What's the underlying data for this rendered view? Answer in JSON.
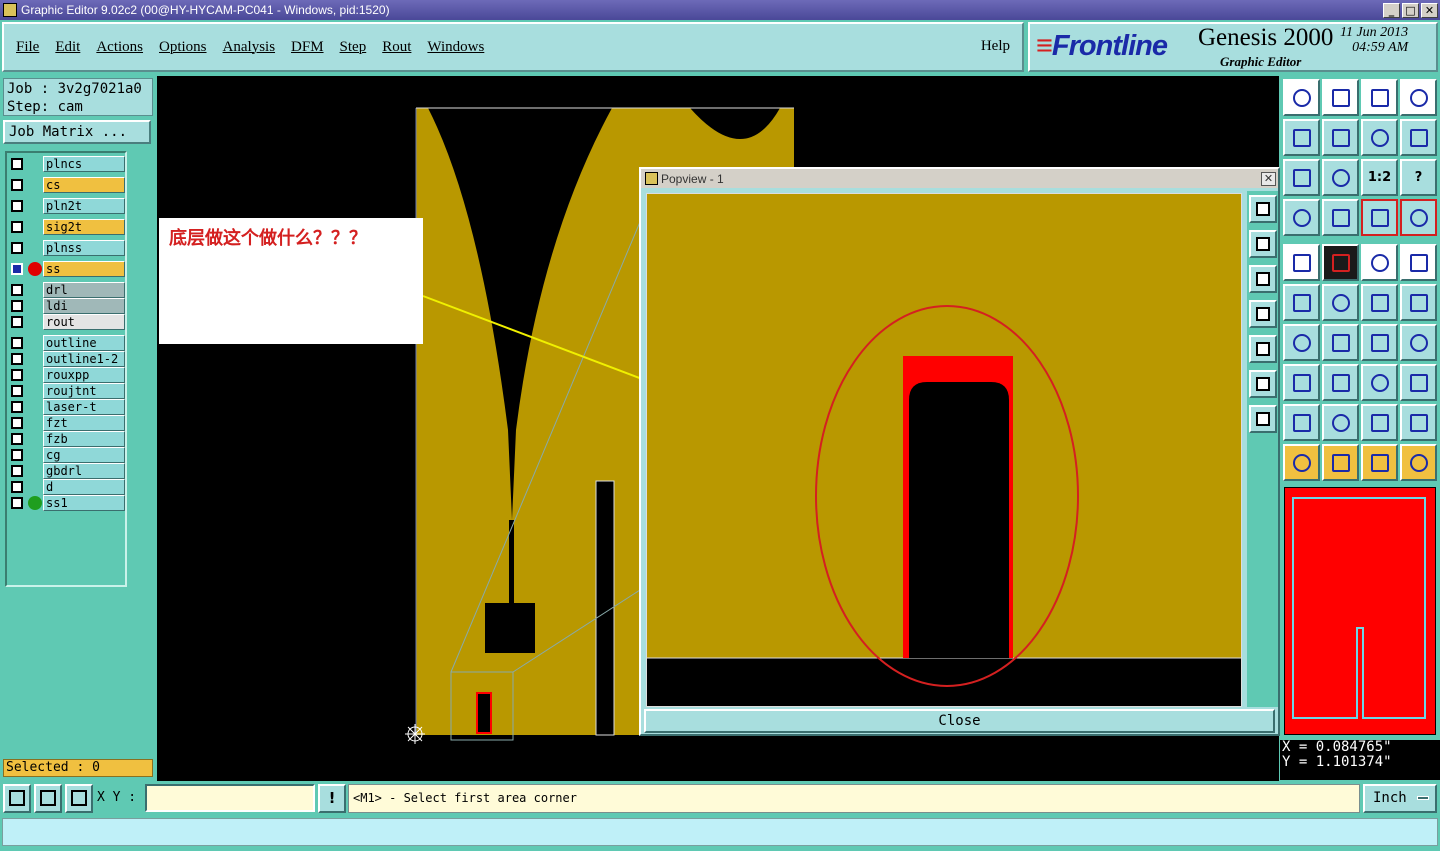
{
  "window": {
    "title": "Graphic Editor 9.02c2 (00@HY-HYCAM-PC041 - Windows, pid:1520)"
  },
  "menu": {
    "items": [
      {
        "id": "file",
        "label": "File"
      },
      {
        "id": "edit",
        "label": "Edit"
      },
      {
        "id": "actions",
        "label": "Actions"
      },
      {
        "id": "options",
        "label": "Options"
      },
      {
        "id": "analysis",
        "label": "Analysis"
      },
      {
        "id": "dfm",
        "label": "DFM"
      },
      {
        "id": "step",
        "label": "Step"
      },
      {
        "id": "rout",
        "label": "Rout"
      },
      {
        "id": "windows",
        "label": "Windows"
      }
    ],
    "help": "Help"
  },
  "brand": {
    "logo": "Frontline",
    "product": "Genesis 2000",
    "subtitle": "Graphic Editor",
    "date": "11 Jun 2013",
    "time": "04:59 AM"
  },
  "job": {
    "job_line": "Job : 3v2g7021a0",
    "step_line": "Step: cam",
    "matrix_button": "Job Matrix ..."
  },
  "layers": [
    {
      "name": "plncs",
      "color": "cyan"
    },
    {
      "name": "cs",
      "color": "yellow"
    },
    {
      "name": "pln2t",
      "color": "cyan"
    },
    {
      "name": "sig2t",
      "color": "yellow"
    },
    {
      "name": "plnss",
      "color": "cyan"
    },
    {
      "name": "ss",
      "color": "yellow",
      "selected": true,
      "dot": "#e00000"
    },
    {
      "name": "drl",
      "color": "grey"
    },
    {
      "name": "ldi",
      "color": "grey"
    },
    {
      "name": "rout",
      "color": "white"
    },
    {
      "name": "outline",
      "color": "cyan"
    },
    {
      "name": "outline1-2",
      "color": "cyan"
    },
    {
      "name": "rouxpp",
      "color": "cyan"
    },
    {
      "name": "roujtnt",
      "color": "cyan"
    },
    {
      "name": "laser-t",
      "color": "cyan"
    },
    {
      "name": "fzt",
      "color": "cyan"
    },
    {
      "name": "fzb",
      "color": "cyan"
    },
    {
      "name": "cg",
      "color": "cyan"
    },
    {
      "name": "gbdrl",
      "color": "cyan"
    },
    {
      "name": "d",
      "color": "cyan"
    },
    {
      "name": "ss1",
      "color": "cyan",
      "dot": "#1f9e1f"
    }
  ],
  "selected_count": "Selected : 0",
  "annotation": {
    "text": "底层做这个做什么？？？"
  },
  "popview": {
    "title": "Popview - 1",
    "close_label": "Close"
  },
  "right_toolbar": {
    "ratio_label": "1:2",
    "help_label": "?"
  },
  "coords": {
    "x": "X = 0.084765\"",
    "y": "Y = 1.101374\""
  },
  "bottom": {
    "xy_label": "X Y :",
    "xy_value": "",
    "warn_label": "!",
    "prompt": "<M1> - Select first area corner",
    "units": "Inch"
  },
  "colors": {
    "copper": "#b99800",
    "highlight": "#ff0000",
    "panel": "#5fc9b3",
    "button": "#a8dede"
  }
}
